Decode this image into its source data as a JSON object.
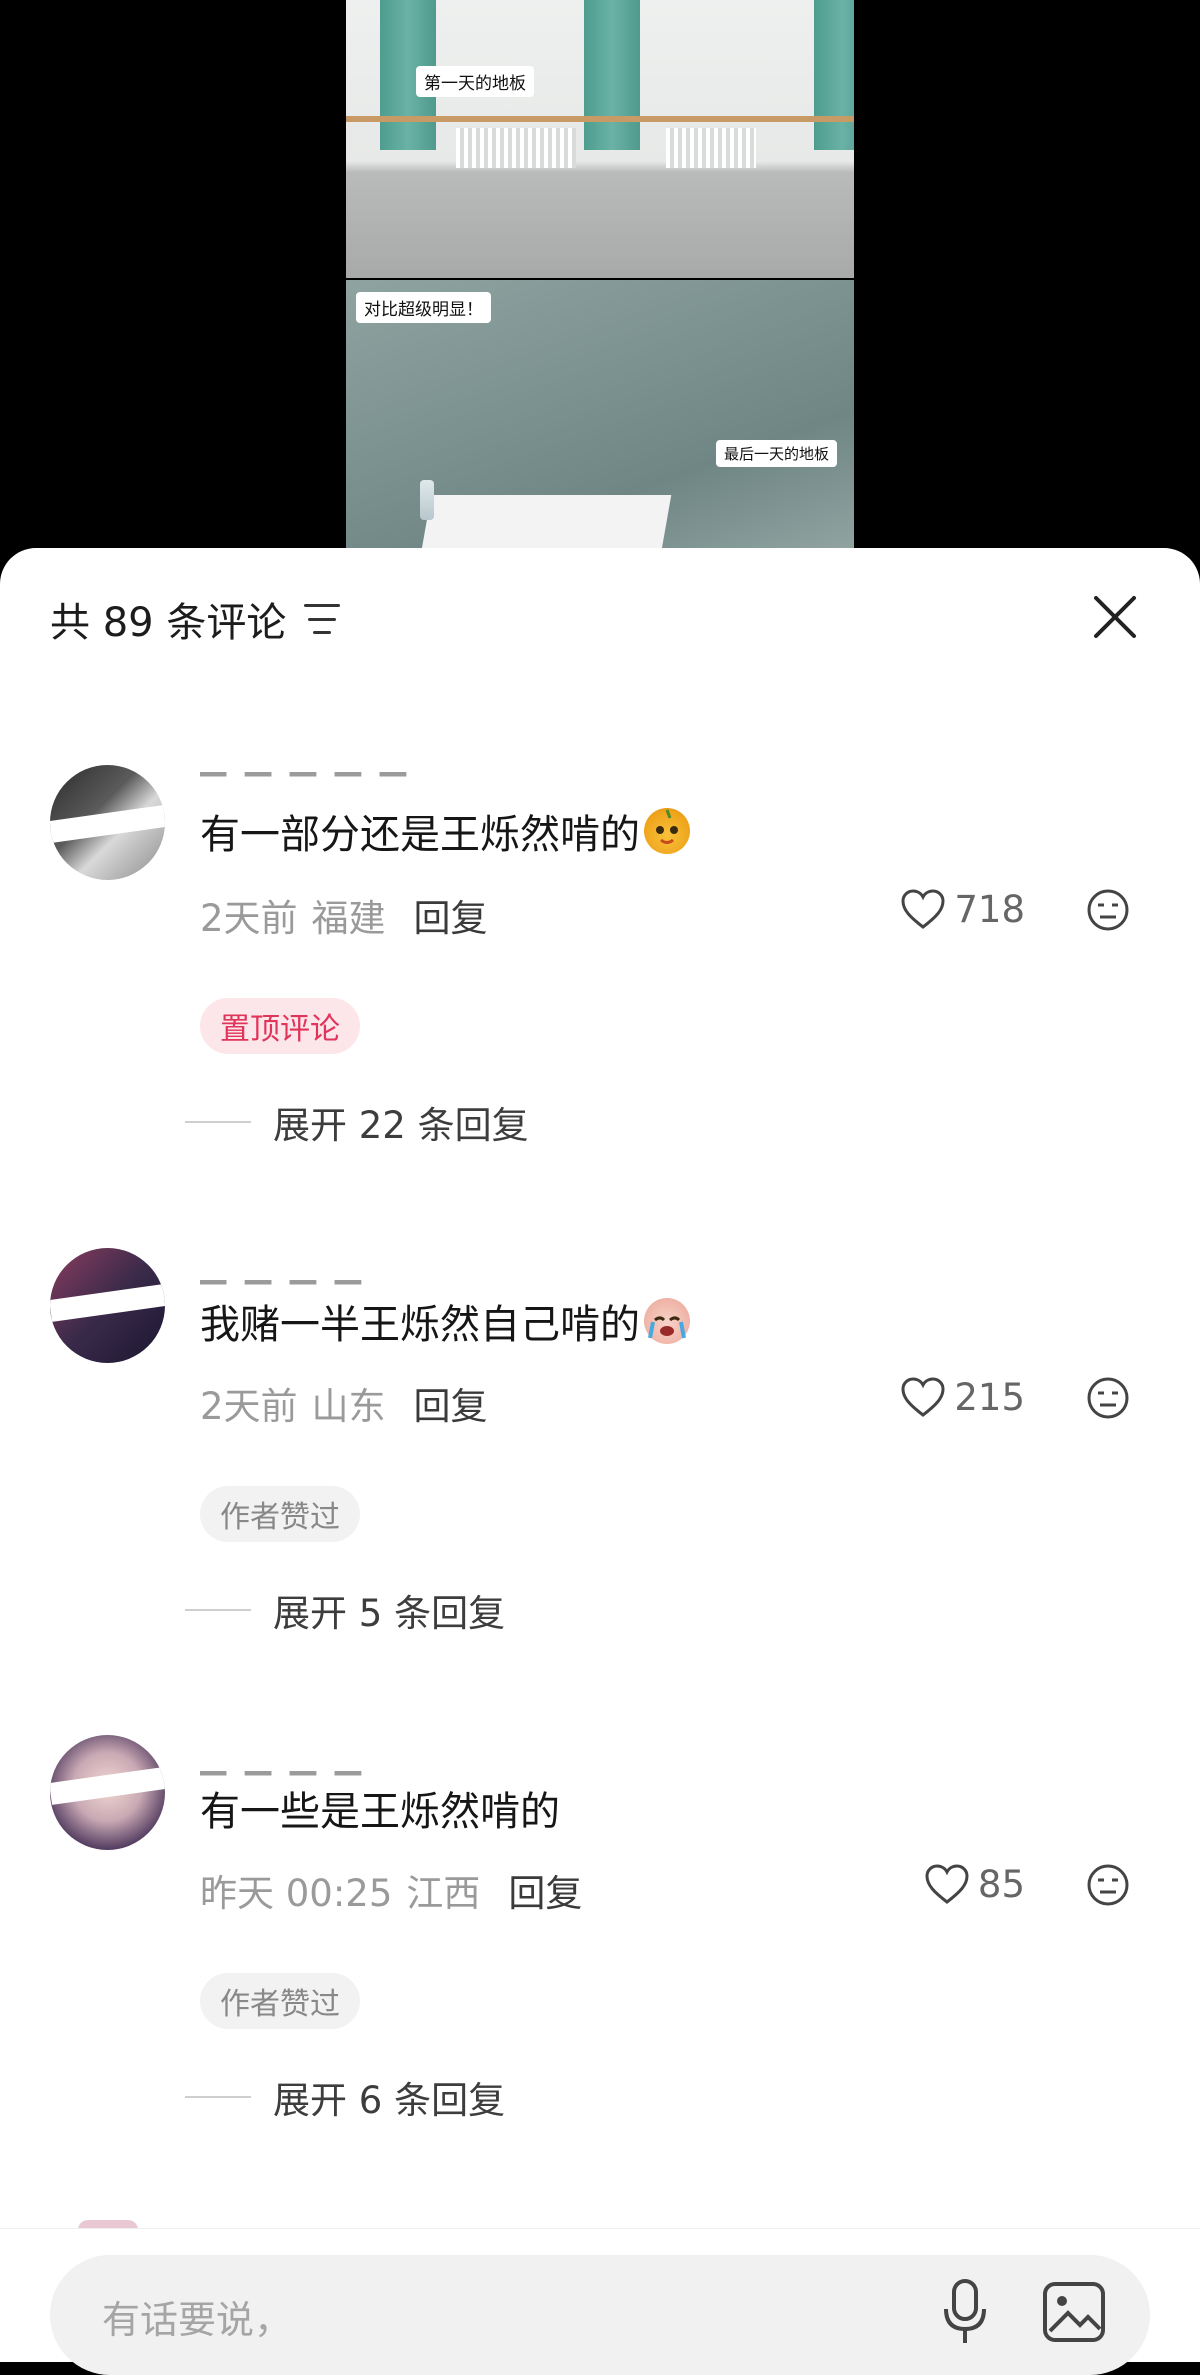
{
  "video": {
    "label_first_day": "第一天的地板",
    "label_contrast": "对比超级明显！",
    "label_last_day": "最后一天的地板"
  },
  "header": {
    "title": "共 89 条评论",
    "filter_icon": "filter-icon",
    "close_icon": "close-icon"
  },
  "comments": [
    {
      "text": "有一部分还是王烁然啃的",
      "emoji": "pear-face-emoji",
      "time": "2天前",
      "location": "福建",
      "reply_label": "回复",
      "likes": "718",
      "badge": "置顶评论",
      "expand": "展开 22 条回复"
    },
    {
      "text": "我赌一半王烁然自己啃的",
      "emoji": "crying-face-emoji",
      "time": "2天前",
      "location": "山东",
      "reply_label": "回复",
      "likes": "215",
      "badge": "作者赞过",
      "expand": "展开 5 条回复"
    },
    {
      "text": "有一些是王烁然啃的",
      "time": "昨天 00:25",
      "location": "江西",
      "reply_label": "回复",
      "likes": "85",
      "badge": "作者赞过",
      "expand": "展开 6 条回复"
    }
  ],
  "input": {
    "placeholder": "有话要说，"
  },
  "colors": {
    "pinned_badge_bg": "#fde6ea",
    "pinned_badge_text": "#e0345a"
  }
}
